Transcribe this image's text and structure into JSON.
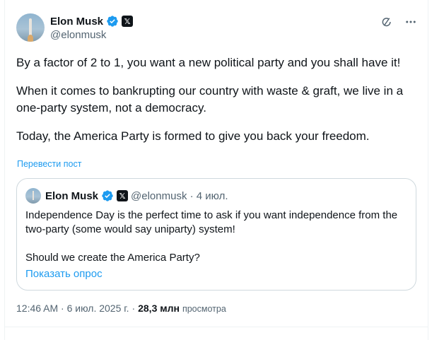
{
  "tweet": {
    "author_name": "Elon Musk",
    "handle": "@elonmusk",
    "x_badge": "𝕏",
    "paragraphs": [
      "By a factor of 2 to 1, you want a new political party and you shall have it!",
      "When it comes to bankrupting our country with waste & graft, we live in a one-party system, not a democracy.",
      "Today, the America Party is formed to give you back your freedom."
    ],
    "translate_link": "Перевести пост",
    "timestamp": "12:46 AM · 6 июл. 2025 г. ·",
    "views_count": "28,3 млн",
    "views_label": "просмотра"
  },
  "quoted": {
    "author_name": "Elon Musk",
    "x_badge": "𝕏",
    "meta": "@elonmusk · 4 июл.",
    "paragraphs": [
      "Independence Day is the perfect time to ask if you want independence from the two-party (some would say uniparty) system!",
      "Should we create the America Party?"
    ],
    "poll_link": "Показать опрос"
  },
  "icons": {
    "verified": "verified-badge-icon",
    "grok": "grok-icon",
    "more": "more-icon"
  },
  "colors": {
    "accent": "#1d9bf0",
    "text": "#0f1419",
    "secondary": "#536471",
    "border": "#cfd9de"
  }
}
